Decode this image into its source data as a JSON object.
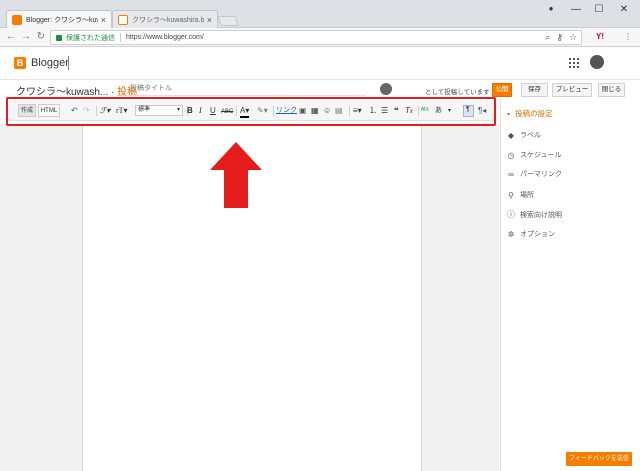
{
  "browser": {
    "tabs": [
      {
        "title": "Blogger: クワシラ〜kuwash",
        "active": true
      },
      {
        "title": "クワシラ〜kuwashira.blog",
        "active": false
      }
    ],
    "secure_label": "保護された通信",
    "url": "https://www.blogger.com/",
    "window_controls": {
      "minimize": "—",
      "maximize": "☐",
      "close": "✕"
    },
    "extension_label": "Y!"
  },
  "header": {
    "logo_letter": "B",
    "app_name": "Blogger"
  },
  "post": {
    "blog_title": "クワシラ〜kuwash...",
    "separator": " · ",
    "section": "投稿",
    "title_placeholder": "投稿タイトル",
    "posting_as": "として投稿しています",
    "publish_label": "公開",
    "save_label": "保存",
    "preview_label": "プレビュー",
    "close_label": "閉じる"
  },
  "toolbar": {
    "compose_label": "作成",
    "html_label": "HTML",
    "font_size_select": "標準",
    "link_label": "リンク"
  },
  "sidebar": {
    "header": "投稿の設定",
    "items": [
      {
        "label": "ラベル",
        "icon": "label-icon"
      },
      {
        "label": "スケジュール",
        "icon": "clock-icon"
      },
      {
        "label": "パーマリンク",
        "icon": "link-icon"
      },
      {
        "label": "場所",
        "icon": "location-icon"
      },
      {
        "label": "検索向け説明",
        "icon": "info-icon"
      },
      {
        "label": "オプション",
        "icon": "gear-icon"
      }
    ]
  },
  "feedback_label": "フィードバックを送信",
  "colors": {
    "accent": "#f57d00",
    "annotation_red": "#e41c1c",
    "secure_green": "#1e8e3e"
  }
}
